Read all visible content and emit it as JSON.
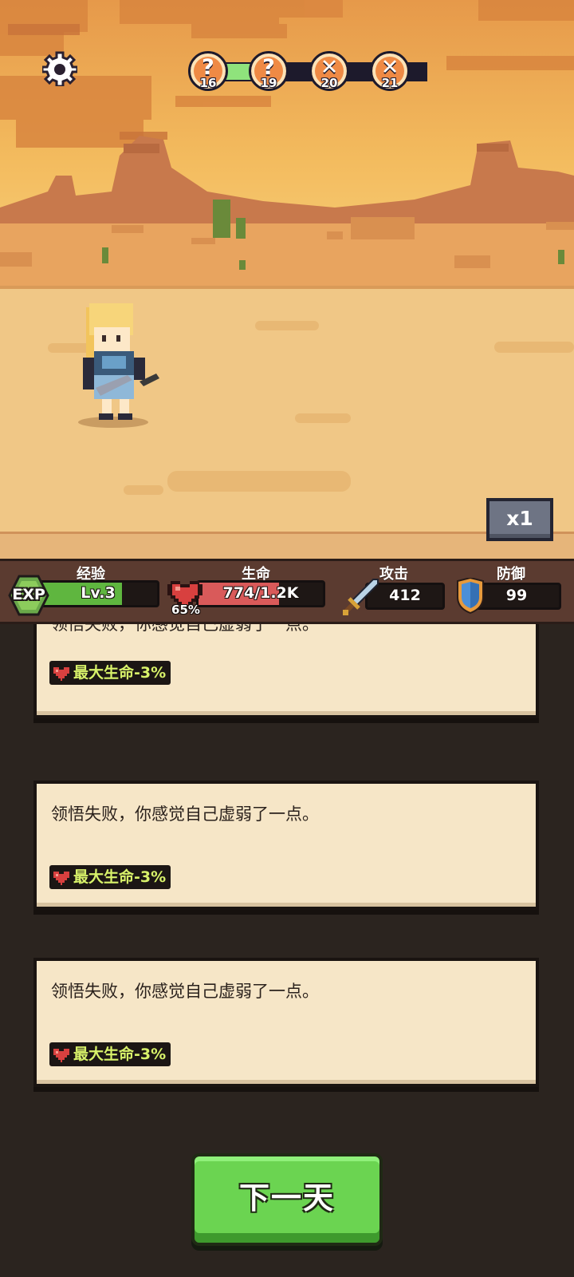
{
  "top": {
    "stages": [
      {
        "number": "16",
        "state": "cleared",
        "glyph": "?"
      },
      {
        "number": "19",
        "state": "current",
        "glyph": "?"
      },
      {
        "number": "20",
        "state": "battle",
        "glyph": "✕"
      },
      {
        "number": "21",
        "state": "battle",
        "glyph": "✕"
      }
    ],
    "progress_fraction": 0.2,
    "speed_label": "x1"
  },
  "stats": {
    "exp": {
      "title": "经验",
      "badge": "EXP",
      "level": "Lv.3",
      "fill_fraction": 0.7
    },
    "hp": {
      "title": "生命",
      "value": "774/1.2K",
      "percent": "65%",
      "fill_fraction": 0.65
    },
    "attack": {
      "title": "攻击",
      "value": "412"
    },
    "defense": {
      "title": "防御",
      "value": "99"
    }
  },
  "events": [
    {
      "message": "领悟失败，你感觉自己虚弱了一点。",
      "effect": "最大生命-3%"
    },
    {
      "message": "领悟失败，你感觉自己虚弱了一点。",
      "effect": "最大生命-3%"
    },
    {
      "message": "领悟失败，你感觉自己虚弱了一点。",
      "effect": "最大生命-3%"
    }
  ],
  "next_button": "下一天",
  "colors": {
    "sky": "#f2b65a",
    "ground": "#f0c786",
    "exp_bar": "#5fb63f",
    "hp_bar": "#d95a5a",
    "effect_text": "#d8f26a",
    "next_button": "#6bd451"
  }
}
